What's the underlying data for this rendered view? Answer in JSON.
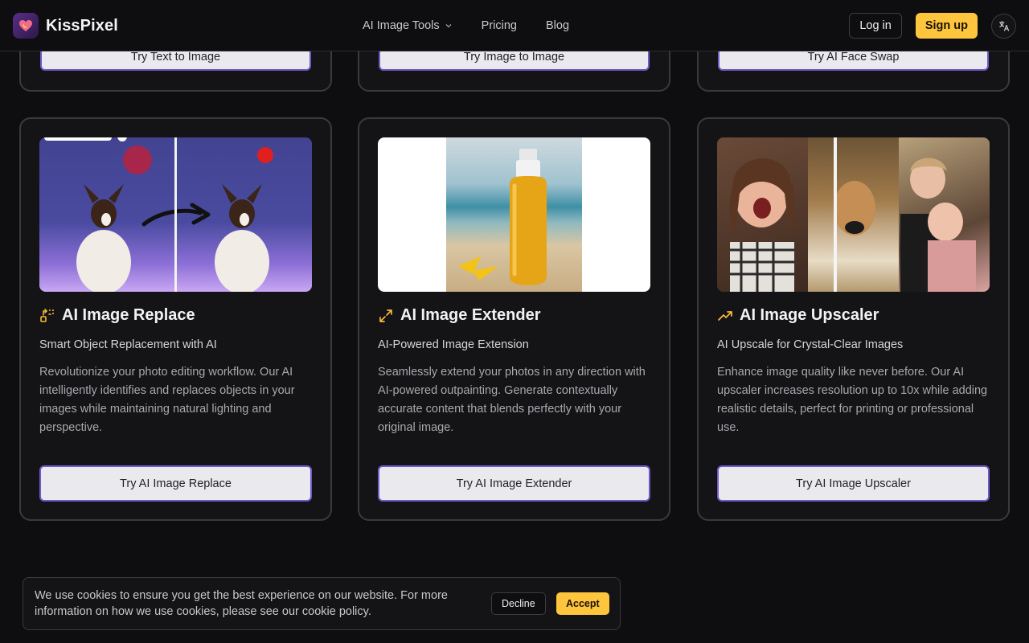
{
  "header": {
    "brand": "KissPixel",
    "nav": [
      {
        "label": "AI Image Tools",
        "icon": "chevron-down-icon"
      },
      {
        "label": "Pricing"
      },
      {
        "label": "Blog"
      }
    ],
    "login_label": "Log in",
    "signup_label": "Sign up",
    "language_icon": "translate-icon"
  },
  "top_row": {
    "buttons": [
      "Try Text to Image",
      "Try Image to Image",
      "Try AI Face Swap"
    ]
  },
  "cards": [
    {
      "title": "AI Image Replace",
      "icon": "replace-icon",
      "subtitle": "Smart Object Replacement with AI",
      "description": "Revolutionize your photo editing workflow. Our AI intelligently identifies and replaces objects in your images while maintaining natural lighting and perspective.",
      "cta": "Try AI Image Replace"
    },
    {
      "title": "AI Image Extender",
      "icon": "expand-arrows-icon",
      "subtitle": "AI-Powered Image Extension",
      "description": "Seamlessly extend your photos in any direction with AI-powered outpainting. Generate contextually accurate content that blends perfectly with your original image.",
      "cta": "Try AI Image Extender"
    },
    {
      "title": "AI Image Upscaler",
      "icon": "trending-up-icon",
      "subtitle": "AI Upscale for Crystal-Clear Images",
      "description": "Enhance image quality like never before. Our AI upscaler increases resolution up to 10x while adding realistic details, perfect for printing or professional use.",
      "cta": "Try AI Image Upscaler"
    }
  ],
  "cookie": {
    "text": "We use cookies to ensure you get the best experience on our website. For more information on how we use cookies, please see our cookie policy.",
    "decline_label": "Decline",
    "accept_label": "Accept"
  },
  "colors": {
    "background": "#0e0e10",
    "card_border": "#3a3a3e",
    "accent_yellow": "#ffc53d",
    "cta_border": "#7258c8",
    "icon_yellow": "#f5b83a"
  }
}
